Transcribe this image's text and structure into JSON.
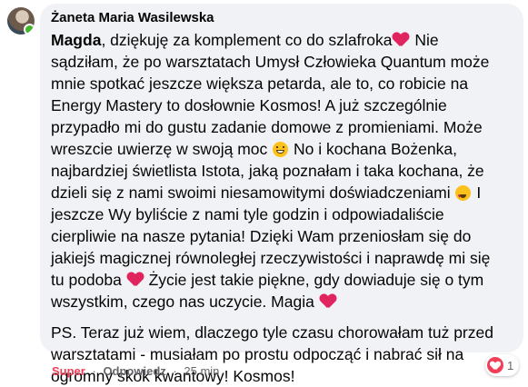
{
  "comment": {
    "author": "Żaneta Maria Wasilewska",
    "mention": "Magda",
    "paragraph1": [
      [
        ", dziękuję za komplement co do szlafroka",
        "heart",
        " Nie"
      ],
      [
        "sądziłam, że po warsztatach Umysł Człowieka Quantum może"
      ],
      [
        "mnie spotkać jeszcze większa petarda, ale to, co robicie na"
      ],
      [
        "Energy Mastery to dosłownie Kosmos! A już szczególnie"
      ],
      [
        "przypadło mi do gustu zadanie domowe z promieniami. Może"
      ],
      [
        "wreszcie uwierzę w swoją moc ",
        "grin",
        " No i kochana Bożenka,"
      ],
      [
        "najbardziej świetlista Istota, jaką poznałam i taka kochana, że"
      ],
      [
        "dzieli się z nami swoimi niesamowitymi doświadczeniami ",
        "hearteyes",
        " I"
      ],
      [
        "jeszcze Wy byliście z nami tyle godzin i odpowiadaliście"
      ],
      [
        "cierpliwie na nasze pytania! Dzięki Wam przeniosłam się do"
      ],
      [
        "jakiejś magicznej równoległej rzeczywistości i naprawdę mi się"
      ],
      [
        "tu podoba ",
        "heart",
        " Życie jest takie piękne, gdy dowiaduje się o tym"
      ],
      [
        "wszystkim, czego nas uczycie. Magia ",
        "heart",
        ""
      ]
    ],
    "paragraph2": [
      "PS. Teraz już wiem, dlaczego tyle czasu chorowałam tuż przed",
      "warsztatami - musiałam po prostu odpocząć i nabrać sił na",
      "ogromny skok kwantowy! Kosmos!"
    ]
  },
  "actions": {
    "like_label": "Super",
    "separator": "·",
    "reply_label": "Odpowiedz",
    "time": "25 min"
  },
  "reactions": {
    "icon": "love-reaction-icon",
    "count": "1"
  },
  "colors": {
    "bubble": "#f0f2f5",
    "liked": "#f33e58",
    "heart": "#e0245e",
    "online": "#42b72a"
  }
}
